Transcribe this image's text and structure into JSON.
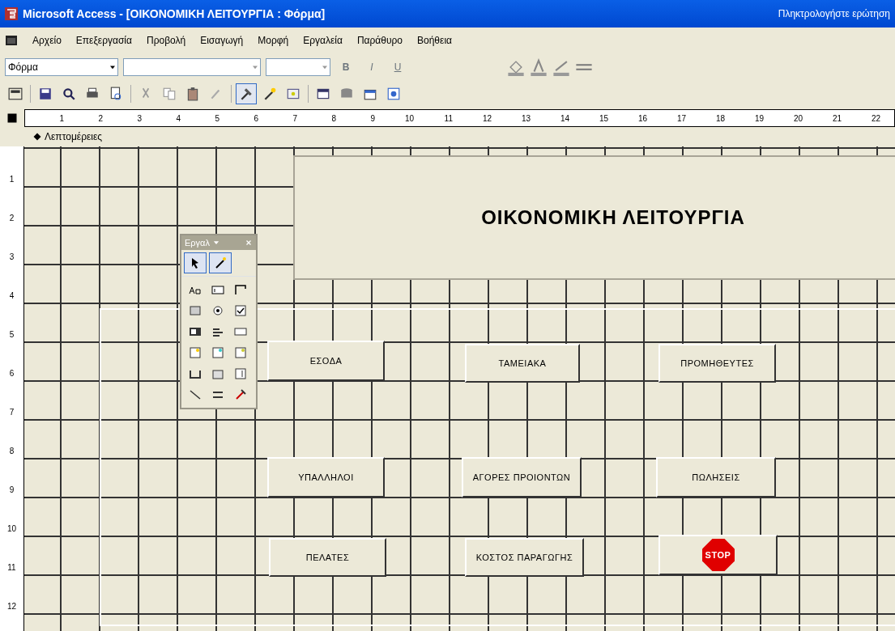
{
  "window": {
    "title": "Microsoft Access - [ΟΙΚΟΝΟΜΙΚΗ ΛΕΙΤΟΥΡΓΙΑ : Φόρμα]",
    "help_box": "Πληκτρολογήστε ερώτηση"
  },
  "menu": [
    "Αρχείο",
    "Επεξεργασία",
    "Προβολή",
    "Εισαγωγή",
    "Μορφή",
    "Εργαλεία",
    "Παράθυρο",
    "Βοήθεια"
  ],
  "format_toolbar": {
    "object": "Φόρμα",
    "bold": "B",
    "italic": "I",
    "underline": "U"
  },
  "design_toolbar": [
    {
      "pressed": false
    },
    {
      "pressed": false
    },
    {
      "pressed": false
    },
    {
      "pressed": false
    },
    {
      "pressed": false
    },
    {
      "pressed": false
    },
    {
      "pressed": false
    },
    {
      "pressed": false
    },
    {
      "pressed": false
    },
    {
      "pressed": true
    },
    {
      "pressed": false
    },
    {
      "pressed": false
    },
    {
      "pressed": false
    },
    {
      "pressed": false
    },
    {
      "pressed": false
    },
    {
      "pressed": false
    }
  ],
  "ruler": [
    "1",
    "2",
    "3",
    "4",
    "5",
    "6",
    "7",
    "8",
    "9",
    "10",
    "11",
    "12",
    "13",
    "14",
    "15",
    "16",
    "17",
    "18",
    "19",
    "20",
    "21",
    "22"
  ],
  "vertical_ruler": [
    "1",
    "2",
    "3",
    "4",
    "5",
    "6",
    "7",
    "8",
    "9",
    "10",
    "11",
    "12"
  ],
  "section": "Λεπτομέρειες",
  "toolbox": {
    "title": "Εργαλ",
    "pointer_selected": true,
    "wizards_on": true
  },
  "form_title": "ΟΙΚΟΝΟΜΙΚΗ ΛΕΙΤΟΥΡΓΙΑ",
  "buttons": [
    {
      "kind": "text",
      "label": "ΕΣΟΔΑ"
    },
    {
      "kind": "text",
      "label": "ΤΑΜΕΙΑΚΑ"
    },
    {
      "kind": "text",
      "label": "ΠΡΟΜΗΘΕΥΤΕΣ"
    },
    {
      "kind": "text",
      "label": "ΥΠΑΛΛΗΛΟΙ"
    },
    {
      "kind": "text",
      "label": "ΑΓΟΡΕΣ ΠΡΟΙΟΝΤΩΝ"
    },
    {
      "kind": "text",
      "label": "ΠΩΛΗΣΕΙΣ"
    },
    {
      "kind": "text",
      "label": "ΠΕΛΑΤΕΣ"
    },
    {
      "kind": "text",
      "label": "ΚΟΣΤΟΣ ΠΑΡΑΓΩΓΗΣ"
    },
    {
      "kind": "stop",
      "label": "STOP"
    }
  ]
}
